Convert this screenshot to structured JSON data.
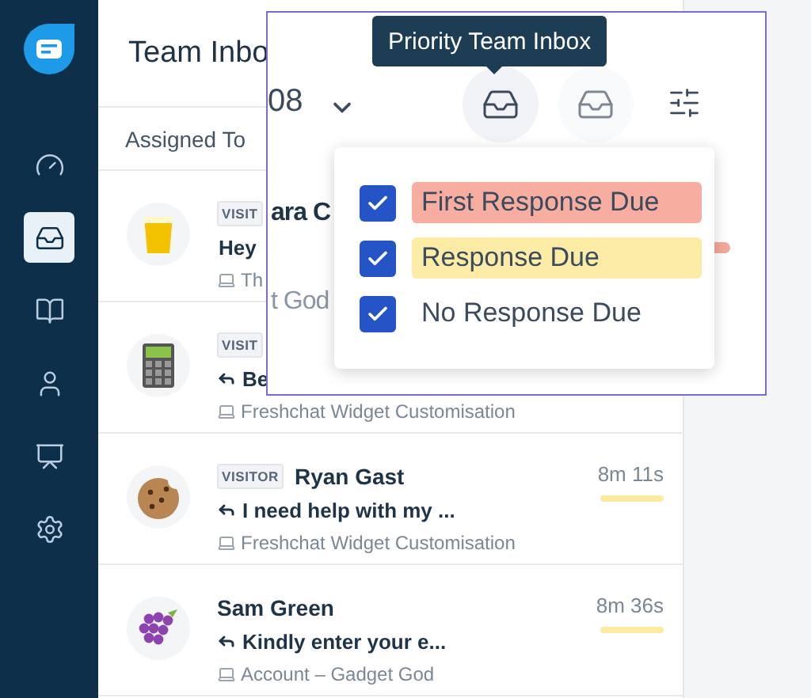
{
  "sidebar": {
    "items": [
      {
        "selected": false
      },
      {
        "selected": true
      },
      {
        "selected": false
      },
      {
        "selected": false
      },
      {
        "selected": false
      },
      {
        "selected": false
      }
    ]
  },
  "header": {
    "title": "Team Inbo"
  },
  "filter_bar": {
    "label": "Assigned To"
  },
  "conversations": [
    {
      "badge": "VISIT",
      "message": "Hey",
      "reply": false,
      "source": "Th"
    },
    {
      "badge": "VISIT",
      "message": "Be",
      "reply": true,
      "source": "Freshchat Widget Customisation"
    },
    {
      "badge": "VISITOR",
      "name": "Ryan Gast",
      "message": "I need help with my ...",
      "reply": true,
      "source": "Freshchat Widget Customisation",
      "time": "8m 11s",
      "color": "#fde9a0"
    },
    {
      "name": "Sam Green",
      "message": "Kindly enter your e...",
      "reply": true,
      "source": "Account – Gadget God",
      "time": "8m 36s",
      "color": "#fde9a0"
    }
  ],
  "overlay": {
    "tooltip": "Priority Team Inbox",
    "count": "08",
    "fragments": [
      "ara C",
      "t God"
    ],
    "peek_bar": {
      "color": "#f4a99a"
    },
    "views": [
      {
        "selected": true
      },
      {
        "selected": false
      }
    ],
    "filters": [
      {
        "label": "First Response Due",
        "checked": true,
        "color": "#f7ad9f"
      },
      {
        "label": "Response Due",
        "checked": true,
        "color": "#fdeca6"
      },
      {
        "label": "No Response Due",
        "checked": true
      }
    ]
  }
}
